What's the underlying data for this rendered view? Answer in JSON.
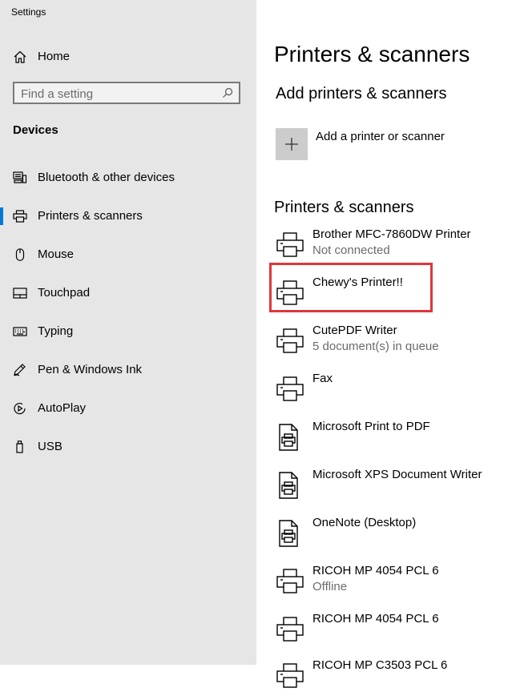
{
  "window": {
    "title": "Settings"
  },
  "sidebar": {
    "home_label": "Home",
    "search_placeholder": "Find a setting",
    "section_title": "Devices",
    "items": [
      {
        "label": "Bluetooth & other devices",
        "icon": "bluetooth-devices-icon"
      },
      {
        "label": "Printers & scanners",
        "icon": "printer-icon",
        "selected": true
      },
      {
        "label": "Mouse",
        "icon": "mouse-icon"
      },
      {
        "label": "Touchpad",
        "icon": "touchpad-icon"
      },
      {
        "label": "Typing",
        "icon": "keyboard-icon"
      },
      {
        "label": "Pen & Windows Ink",
        "icon": "pen-icon"
      },
      {
        "label": "AutoPlay",
        "icon": "autoplay-icon"
      },
      {
        "label": "USB",
        "icon": "usb-icon"
      }
    ]
  },
  "main": {
    "title": "Printers & scanners",
    "add_section_title": "Add printers & scanners",
    "add_label": "Add a printer or scanner",
    "list_title": "Printers & scanners",
    "printers": [
      {
        "name": "Brother MFC-7860DW Printer",
        "status": "Not connected",
        "icon": "printer-icon"
      },
      {
        "name": "Chewy's Printer!!",
        "status": "",
        "icon": "printer-icon",
        "highlighted": true
      },
      {
        "name": "CutePDF Writer",
        "status": "5 document(s) in queue",
        "icon": "printer-icon"
      },
      {
        "name": "Fax",
        "status": "",
        "icon": "printer-icon"
      },
      {
        "name": "Microsoft Print to PDF",
        "status": "",
        "icon": "document-printer-icon"
      },
      {
        "name": "Microsoft XPS Document Writer",
        "status": "",
        "icon": "document-printer-icon"
      },
      {
        "name": "OneNote (Desktop)",
        "status": "",
        "icon": "document-printer-icon"
      },
      {
        "name": "RICOH MP 4054 PCL 6",
        "status": "Offline",
        "icon": "printer-icon"
      },
      {
        "name": "RICOH MP 4054 PCL 6",
        "status": "",
        "icon": "printer-icon"
      },
      {
        "name": "RICOH MP C3503 PCL 6",
        "status": "",
        "icon": "printer-icon"
      }
    ]
  },
  "colors": {
    "sidebar_bg": "#e6e6e6",
    "accent": "#0078d7",
    "highlight_border": "#e0363c",
    "add_button_bg": "#cccccc",
    "status_text": "#6b6b6b"
  }
}
